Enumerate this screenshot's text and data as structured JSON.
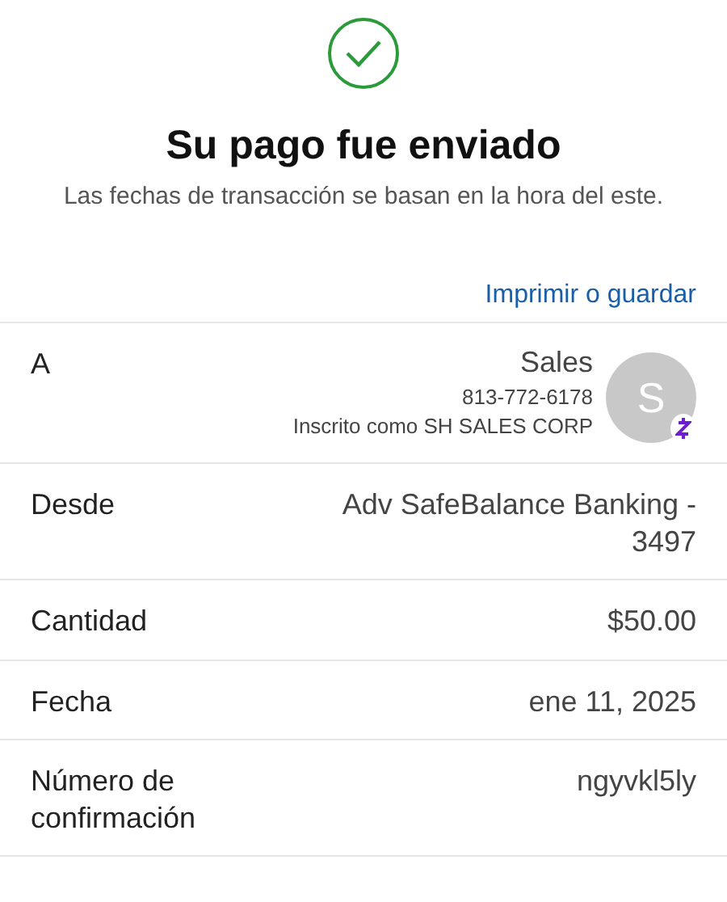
{
  "header": {
    "title": "Su pago fue enviado",
    "subtitle": "Las fechas de transacción se basan en la hora del este.",
    "link": "Imprimir o guardar"
  },
  "rows": [
    {
      "kind": "recipient",
      "label": "A",
      "name": "Sales",
      "phone": "813-772-6178",
      "enrolled": "Inscrito como SH SALES CORP",
      "avatar_initial": "S"
    },
    {
      "kind": "simple",
      "label": "Desde",
      "value": "Adv SafeBalance Banking - 3497"
    },
    {
      "kind": "simple",
      "label": "Cantidad",
      "value": "$50.00"
    },
    {
      "kind": "simple",
      "label": "Fecha",
      "value": "ene 11, 2025"
    },
    {
      "kind": "simple",
      "label": "Número de confirmación",
      "value": "ngyvkl5ly"
    }
  ]
}
